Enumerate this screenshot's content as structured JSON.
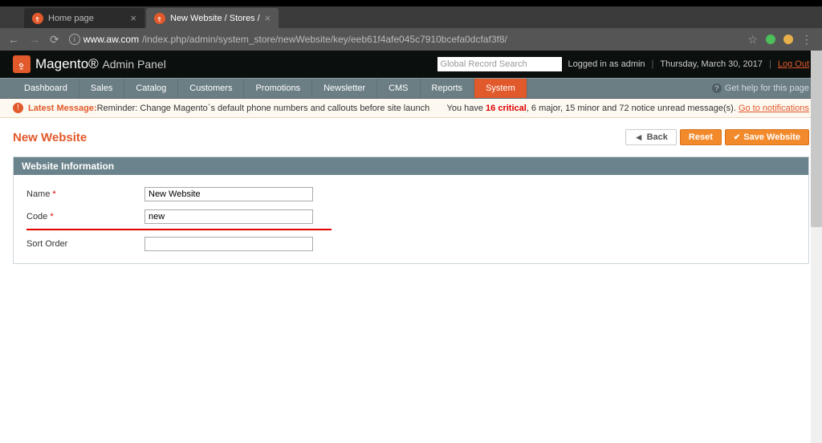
{
  "browser": {
    "tabs": [
      {
        "title": "Home page",
        "active": false
      },
      {
        "title": "New Website / Stores /",
        "active": true
      }
    ],
    "url_prefix": "www.aw.com",
    "url_path": "/index.php/admin/system_store/newWebsite/key/eeb61f4afe045c7910bcefa0dcfaf3f8/"
  },
  "header": {
    "brand_main": "Magento",
    "brand_sub": "Admin Panel",
    "search_placeholder": "Global Record Search",
    "logged_in": "Logged in as admin",
    "date": "Thursday, March 30, 2017",
    "logout": "Log Out"
  },
  "nav": {
    "items": [
      "Dashboard",
      "Sales",
      "Catalog",
      "Customers",
      "Promotions",
      "Newsletter",
      "CMS",
      "Reports",
      "System"
    ],
    "active_index": 8,
    "help": "Get help for this page"
  },
  "message": {
    "latest_label": "Latest Message:",
    "latest_text": " Reminder: Change Magento`s default phone numbers and callouts before site launch",
    "right_prefix": "You have ",
    "critical_count": "16 critical",
    "right_mid": ", 6 major, 15 minor and 72 notice unread message(s). ",
    "link": "Go to notifications"
  },
  "page": {
    "title": "New Website",
    "buttons": {
      "back": "Back",
      "reset": "Reset",
      "save": "Save Website"
    }
  },
  "form": {
    "section_title": "Website Information",
    "fields": {
      "name": {
        "label": "Name",
        "required": "*",
        "value": "New Website"
      },
      "code": {
        "label": "Code",
        "required": "*",
        "value": "new"
      },
      "sort": {
        "label": "Sort Order",
        "required": "",
        "value": ""
      }
    }
  }
}
